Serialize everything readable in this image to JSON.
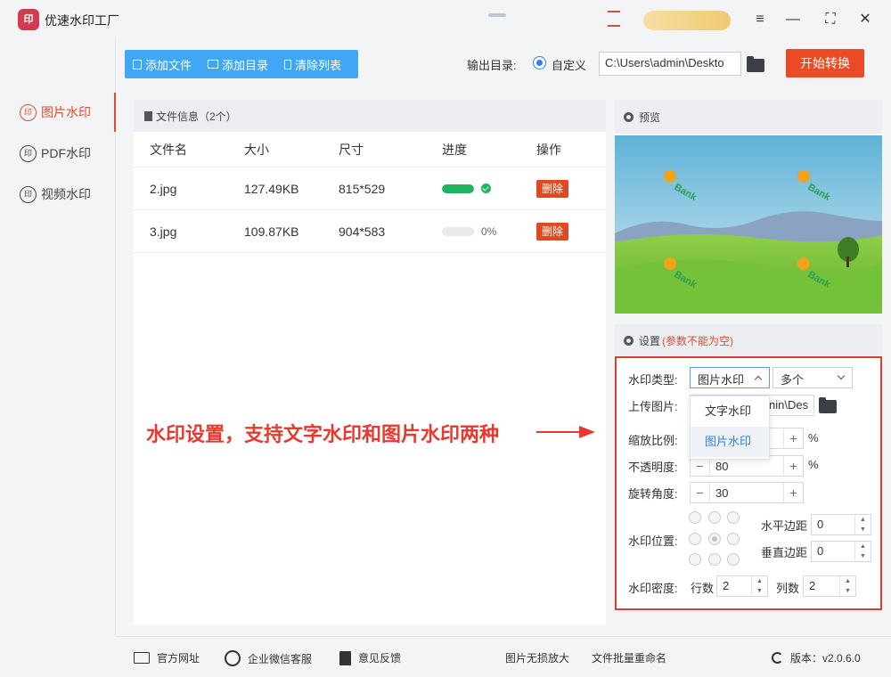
{
  "app": {
    "logo_text": "印",
    "title": "优速水印工厂",
    "window_controls": {
      "menu": "≡",
      "minimize": "—",
      "maximize": "⛶",
      "close": "✕"
    }
  },
  "sidebar": {
    "icon_text": "印",
    "items": [
      {
        "label": "图片水印",
        "active": true
      },
      {
        "label": "PDF水印",
        "active": false
      },
      {
        "label": "视频水印",
        "active": false
      }
    ]
  },
  "toolbar": {
    "add_file": "添加文件",
    "add_folder": "添加目录",
    "clear_list": "清除列表",
    "output_label": "输出目录:",
    "output_option": "自定义",
    "output_path": "C:\\Users\\admin\\Deskto",
    "start_button": "开始转换"
  },
  "files": {
    "header": "文件信息（2个）",
    "columns": [
      "文件名",
      "大小",
      "尺寸",
      "进度",
      "操作"
    ],
    "rows": [
      {
        "name": "2.jpg",
        "size": "127.49KB",
        "dims": "815*529",
        "progress": 1.0,
        "progress_text": "",
        "action": "删除"
      },
      {
        "name": "3.jpg",
        "size": "109.87KB",
        "dims": "904*583",
        "progress": 0.0,
        "progress_text": "0%",
        "action": "删除"
      }
    ]
  },
  "preview": {
    "title": "预览",
    "watermark_text": "Bank"
  },
  "settings": {
    "title": "设置",
    "note": "(参数不能为空)",
    "watermark_type_label": "水印类型:",
    "watermark_type_value": "图片水印",
    "multi_value": "多个",
    "upload_label": "上传图片:",
    "upload_path": "nin\\Des",
    "scale_label": "缩放比例:",
    "scale_unit": "%",
    "opacity_label": "不透明度:",
    "opacity_value": "80",
    "opacity_unit": "%",
    "rotation_label": "旋转角度:",
    "rotation_value": "30",
    "position_label": "水印位置:",
    "h_margin_label": "水平边距",
    "h_margin_value": "0",
    "v_margin_label": "垂直边距",
    "v_margin_value": "0",
    "density_label": "水印密度:",
    "rows_label": "行数",
    "rows_value": "2",
    "cols_label": "列数",
    "cols_value": "2",
    "minus": "−",
    "plus": "+",
    "dropdown": [
      {
        "label": "文字水印",
        "active": false
      },
      {
        "label": "图片水印",
        "active": true
      }
    ]
  },
  "annotation": {
    "text": "水印设置，支持文字水印和图片水印两种",
    "color": "#e8392f"
  },
  "footer": {
    "website": "官方网址",
    "wechat": "企业微信客服",
    "feedback": "意见反馈",
    "lossless": "图片无损放大",
    "rename": "文件批量重命名",
    "version": "版本：v2.0.6.0"
  },
  "colors": {
    "accent_red": "#ea4a24",
    "toolbar_blue": "#3fa7f3",
    "progress_green": "#21b45e",
    "link_blue": "#2f80ed"
  }
}
